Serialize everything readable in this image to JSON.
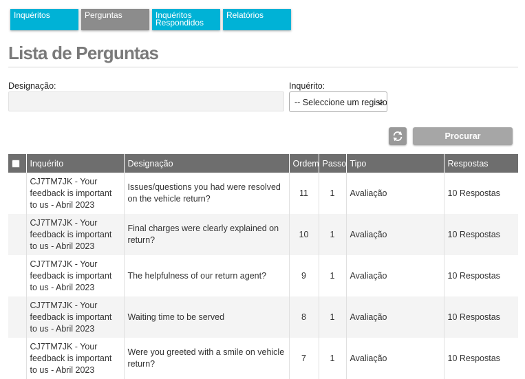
{
  "tabs": [
    {
      "label": "Inquéritos",
      "color": "#00b2d6"
    },
    {
      "label": "Perguntas",
      "color": "#8c8c8c"
    },
    {
      "label": "Inquéritos Respondidos",
      "color": "#00b2d6"
    },
    {
      "label": "Relatórios",
      "color": "#00b2d6"
    }
  ],
  "page": {
    "title": "Lista de Perguntas"
  },
  "filters": {
    "designacao_label": "Designação:",
    "designacao_value": "",
    "inquerito_label": "Inquérito:",
    "inquerito_selected": "-- Seleccione um registo --",
    "search_label": "Procurar",
    "refresh_icon": "refresh-icon"
  },
  "table": {
    "headers": {
      "inquerito": "Inquérito",
      "designacao": "Designação",
      "ordem": "Ordem",
      "passo": "Passo",
      "tipo": "Tipo",
      "respostas": "Respostas"
    },
    "rows": [
      {
        "inquerito": "CJ7TM7JK - Your feedback is important to us - Abril 2023",
        "designacao": "Issues/questions you had were resolved on the vehicle return?",
        "ordem": "11",
        "passo": "1",
        "tipo": "Avaliação",
        "respostas": "10 Respostas"
      },
      {
        "inquerito": "CJ7TM7JK - Your feedback is important to us - Abril 2023",
        "designacao": "Final charges were clearly explained on return?",
        "ordem": "10",
        "passo": "1",
        "tipo": "Avaliação",
        "respostas": "10 Respostas"
      },
      {
        "inquerito": "CJ7TM7JK - Your feedback is important to us - Abril 2023",
        "designacao": "The helpfulness of our return agent?",
        "ordem": "9",
        "passo": "1",
        "tipo": "Avaliação",
        "respostas": "10 Respostas"
      },
      {
        "inquerito": "CJ7TM7JK - Your feedback is important to us - Abril 2023",
        "designacao": "Waiting time to be served",
        "ordem": "8",
        "passo": "1",
        "tipo": "Avaliação",
        "respostas": "10 Respostas"
      },
      {
        "inquerito": "CJ7TM7JK - Your feedback is important to us - Abril 2023",
        "designacao": "Were you greeted with a smile on vehicle return?",
        "ordem": "7",
        "passo": "1",
        "tipo": "Avaliação",
        "respostas": "10 Respostas"
      }
    ]
  }
}
